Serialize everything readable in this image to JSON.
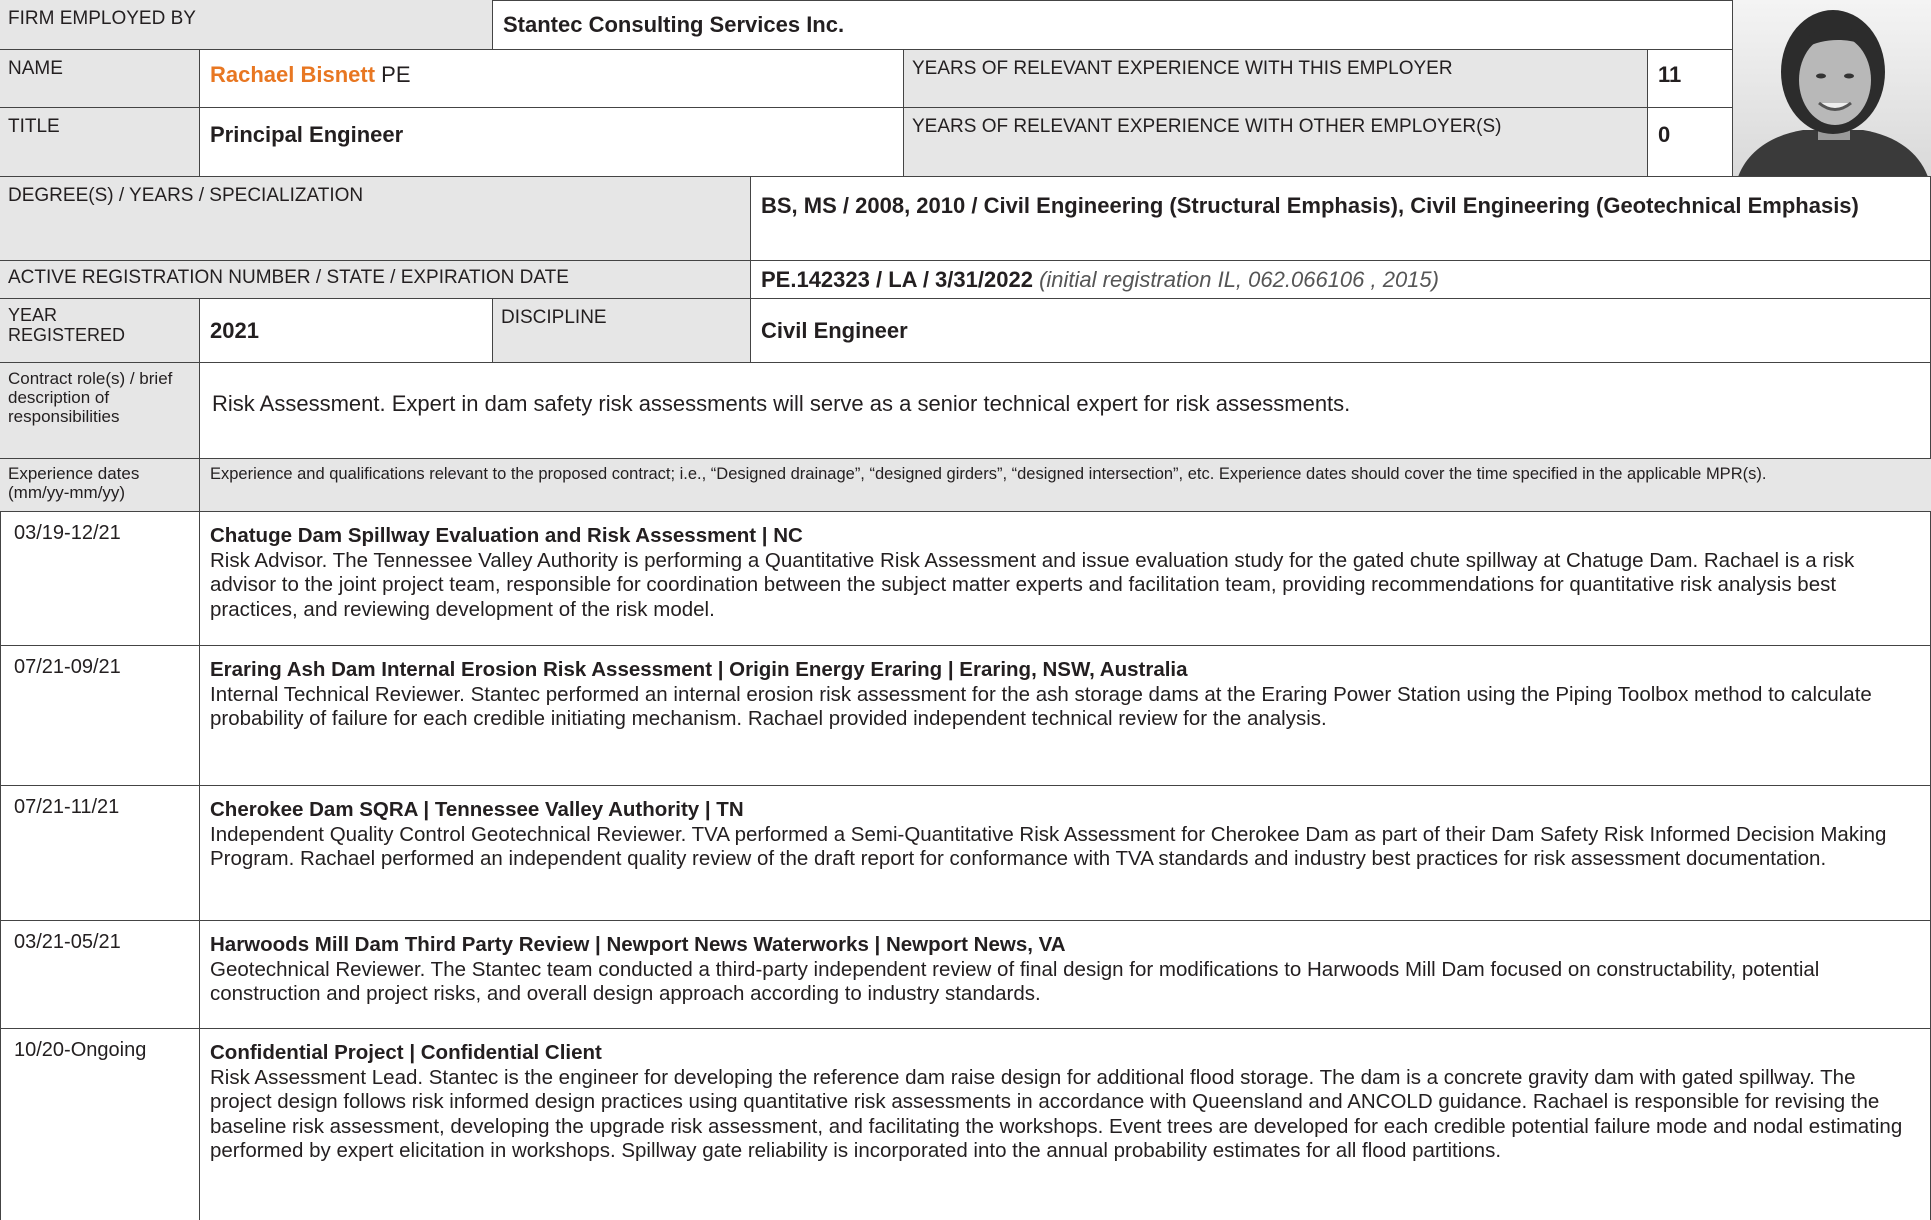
{
  "firm": {
    "label": "FIRM EMPLOYED BY",
    "value": "Stantec Consulting Services Inc."
  },
  "name": {
    "label": "NAME",
    "first_last": "Rachael Bisnett",
    "suffix": " PE"
  },
  "title": {
    "label": "TITLE",
    "value": "Principal Engineer"
  },
  "years_this": {
    "label": "YEARS OF RELEVANT EXPERIENCE WITH THIS EMPLOYER",
    "value": "11"
  },
  "years_other": {
    "label": "YEARS OF RELEVANT EXPERIENCE WITH OTHER EMPLOYER(S)",
    "value": "0"
  },
  "degree": {
    "label": "DEGREE(S) / YEARS / SPECIALIZATION",
    "value": "BS, MS / 2008, 2010 / Civil Engineering (Structural Emphasis), Civil Engineering (Geotechnical Emphasis)"
  },
  "registration": {
    "label": "ACTIVE REGISTRATION NUMBER / STATE / EXPIRATION DATE",
    "value": "PE.142323 / LA / 3/31/2022",
    "note": "(initial registration IL, 062.066106 , 2015)"
  },
  "year_registered": {
    "label": "YEAR REGISTERED",
    "value": "2021"
  },
  "discipline": {
    "label": "DISCIPLINE",
    "value": "Civil Engineer"
  },
  "contract_role": {
    "label": "Contract role(s) / brief description of responsibilities",
    "value": "Risk Assessment. Expert in dam safety risk assessments will serve as a senior technical expert for risk assessments."
  },
  "experience_header": {
    "label": "Experience dates (mm/yy-mm/yy)",
    "value": "Experience and qualifications relevant to the proposed contract; i.e., “Designed drainage”, “designed girders”, “designed intersection”, etc. Experience dates should cover the time specified in the applicable MPR(s)."
  },
  "experience": [
    {
      "dates": "03/19-12/21",
      "title": "Chatuge Dam Spillway Evaluation and Risk Assessment | NC",
      "desc": "Risk Advisor. The Tennessee Valley Authority is performing a Quantitative Risk Assessment and issue evaluation study for the gated chute spillway at Chatuge Dam. Rachael is a risk advisor to the joint project team, responsible for coordination between the subject matter experts and facilitation team, providing recommendations for quantitative risk analysis best practices, and reviewing development of the risk model."
    },
    {
      "dates": "07/21-09/21",
      "title": "Eraring Ash Dam Internal Erosion Risk Assessment | Origin Energy Eraring | Eraring, NSW, Australia",
      "desc": "Internal Technical Reviewer. Stantec performed an internal erosion risk assessment for the ash storage dams at the Eraring Power Station using the Piping Toolbox method to calculate probability of failure for each credible initiating mechanism. Rachael provided independent technical review for the analysis."
    },
    {
      "dates": "07/21-11/21",
      "title": "Cherokee Dam SQRA | Tennessee Valley Authority | TN",
      "desc": "Independent Quality Control Geotechnical Reviewer. TVA performed a Semi-Quantitative Risk Assessment for Cherokee Dam as part of their Dam Safety Risk Informed Decision Making Program. Rachael performed an independent quality review of the draft report for conformance with TVA standards and industry best practices for risk assessment documentation."
    },
    {
      "dates": "03/21-05/21",
      "title": "Harwoods Mill Dam Third Party Review | Newport News Waterworks | Newport News, VA",
      "desc": "Geotechnical Reviewer. The Stantec team conducted a third-party independent review of final design for modifications to Harwoods Mill Dam focused on constructability, potential construction and project risks, and overall design approach according to industry standards."
    },
    {
      "dates": "10/20-Ongoing",
      "title": "Confidential Project | Confidential Client",
      "desc": "Risk Assessment Lead. Stantec is the engineer for developing the reference dam raise design for additional flood storage. The dam is a concrete gravity dam with gated spillway. The project design follows risk informed design practices using quantitative risk assessments in accordance with Queensland and ANCOLD guidance. Rachael is responsible for revising the baseline risk assessment, developing the upgrade risk assessment, and facilitating the workshops. Event trees are developed for each credible potential failure mode and nodal estimating performed by expert elicitation in workshops. Spillway gate reliability is incorporated into the annual probability estimates for all flood partitions."
    }
  ]
}
